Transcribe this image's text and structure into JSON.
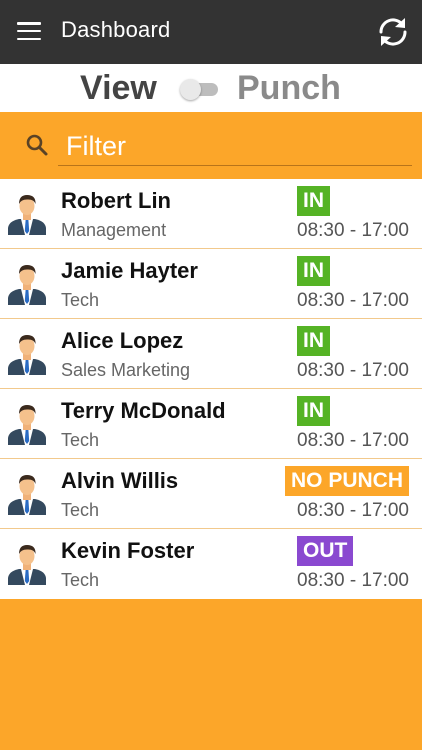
{
  "appbar": {
    "title": "Dashboard",
    "menu_icon": "hamburger-menu-icon",
    "refresh_icon": "refresh-icon"
  },
  "mode_toggle": {
    "left_label": "View",
    "right_label": "Punch",
    "is_on": false
  },
  "filter": {
    "placeholder": "Filter",
    "value": ""
  },
  "colors": {
    "appbar": "#333333",
    "accent": "#fca629",
    "status_in": "#55b325",
    "status_out": "#8a49d0",
    "status_no_punch": "#fca629"
  },
  "employees": [
    {
      "name": "Robert Lin",
      "department": "Management",
      "status": "IN",
      "shift": "08:30 - 17:00"
    },
    {
      "name": "Jamie Hayter",
      "department": "Tech",
      "status": "IN",
      "shift": "08:30 - 17:00"
    },
    {
      "name": "Alice Lopez",
      "department": "Sales Marketing",
      "status": "IN",
      "shift": "08:30 - 17:00"
    },
    {
      "name": "Terry McDonald",
      "department": "Tech",
      "status": "IN",
      "shift": "08:30 - 17:00"
    },
    {
      "name": "Alvin Willis",
      "department": "Tech",
      "status": "NO PUNCH",
      "shift": "08:30 - 17:00"
    },
    {
      "name": "Kevin Foster",
      "department": "Tech",
      "status": "OUT",
      "shift": "08:30 - 17:00"
    }
  ]
}
